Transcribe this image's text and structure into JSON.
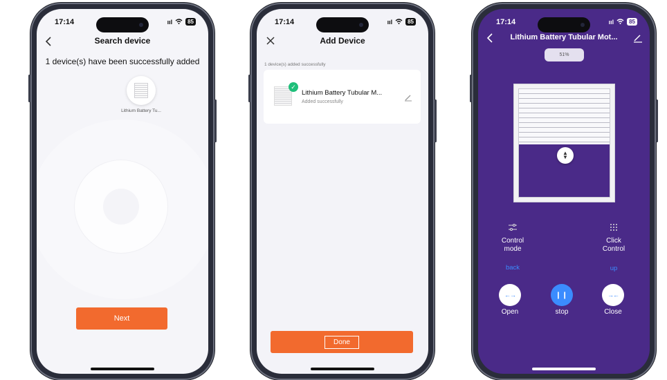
{
  "status_bar": {
    "time": "17:14",
    "signal": "ııl",
    "battery": "85"
  },
  "screen1": {
    "title": "Search device",
    "message": "1 device(s) have been successfully added",
    "device_label": "Lithium Battery Tu...",
    "next_label": "Next",
    "icons": {
      "back": "chevron-left-icon",
      "device": "blind-icon"
    }
  },
  "screen2": {
    "title": "Add Device",
    "subtitle": "1 device(s) added successfully",
    "device_name": "Lithium Battery Tubular M...",
    "device_status": "Added successfully",
    "done_label": "Done",
    "accent": "#f26a2e",
    "success_color": "#1fbf7a",
    "icons": {
      "close": "close-icon",
      "check": "check-icon",
      "edit": "pencil-icon"
    }
  },
  "screen3": {
    "title": "Lithium Battery Tubular Mot...",
    "percent": "51%",
    "blind_open_fraction": 0.51,
    "control_mode_label": "Control mode",
    "control_mode_value": "back",
    "click_control_label": "Click Control",
    "click_control_value": "up",
    "open_label": "Open",
    "stop_label": "stop",
    "close_label": "Close",
    "background": "#4a2a88",
    "link_color": "#3b8cff",
    "icons": {
      "back": "chevron-left-icon",
      "edit": "pencil-icon",
      "control_mode": "sliders-icon",
      "click_control": "grid-dots-icon",
      "open": "arrows-out-icon",
      "stop": "pause-icon",
      "close": "arrows-in-icon",
      "drag": "up-down-icon"
    }
  }
}
